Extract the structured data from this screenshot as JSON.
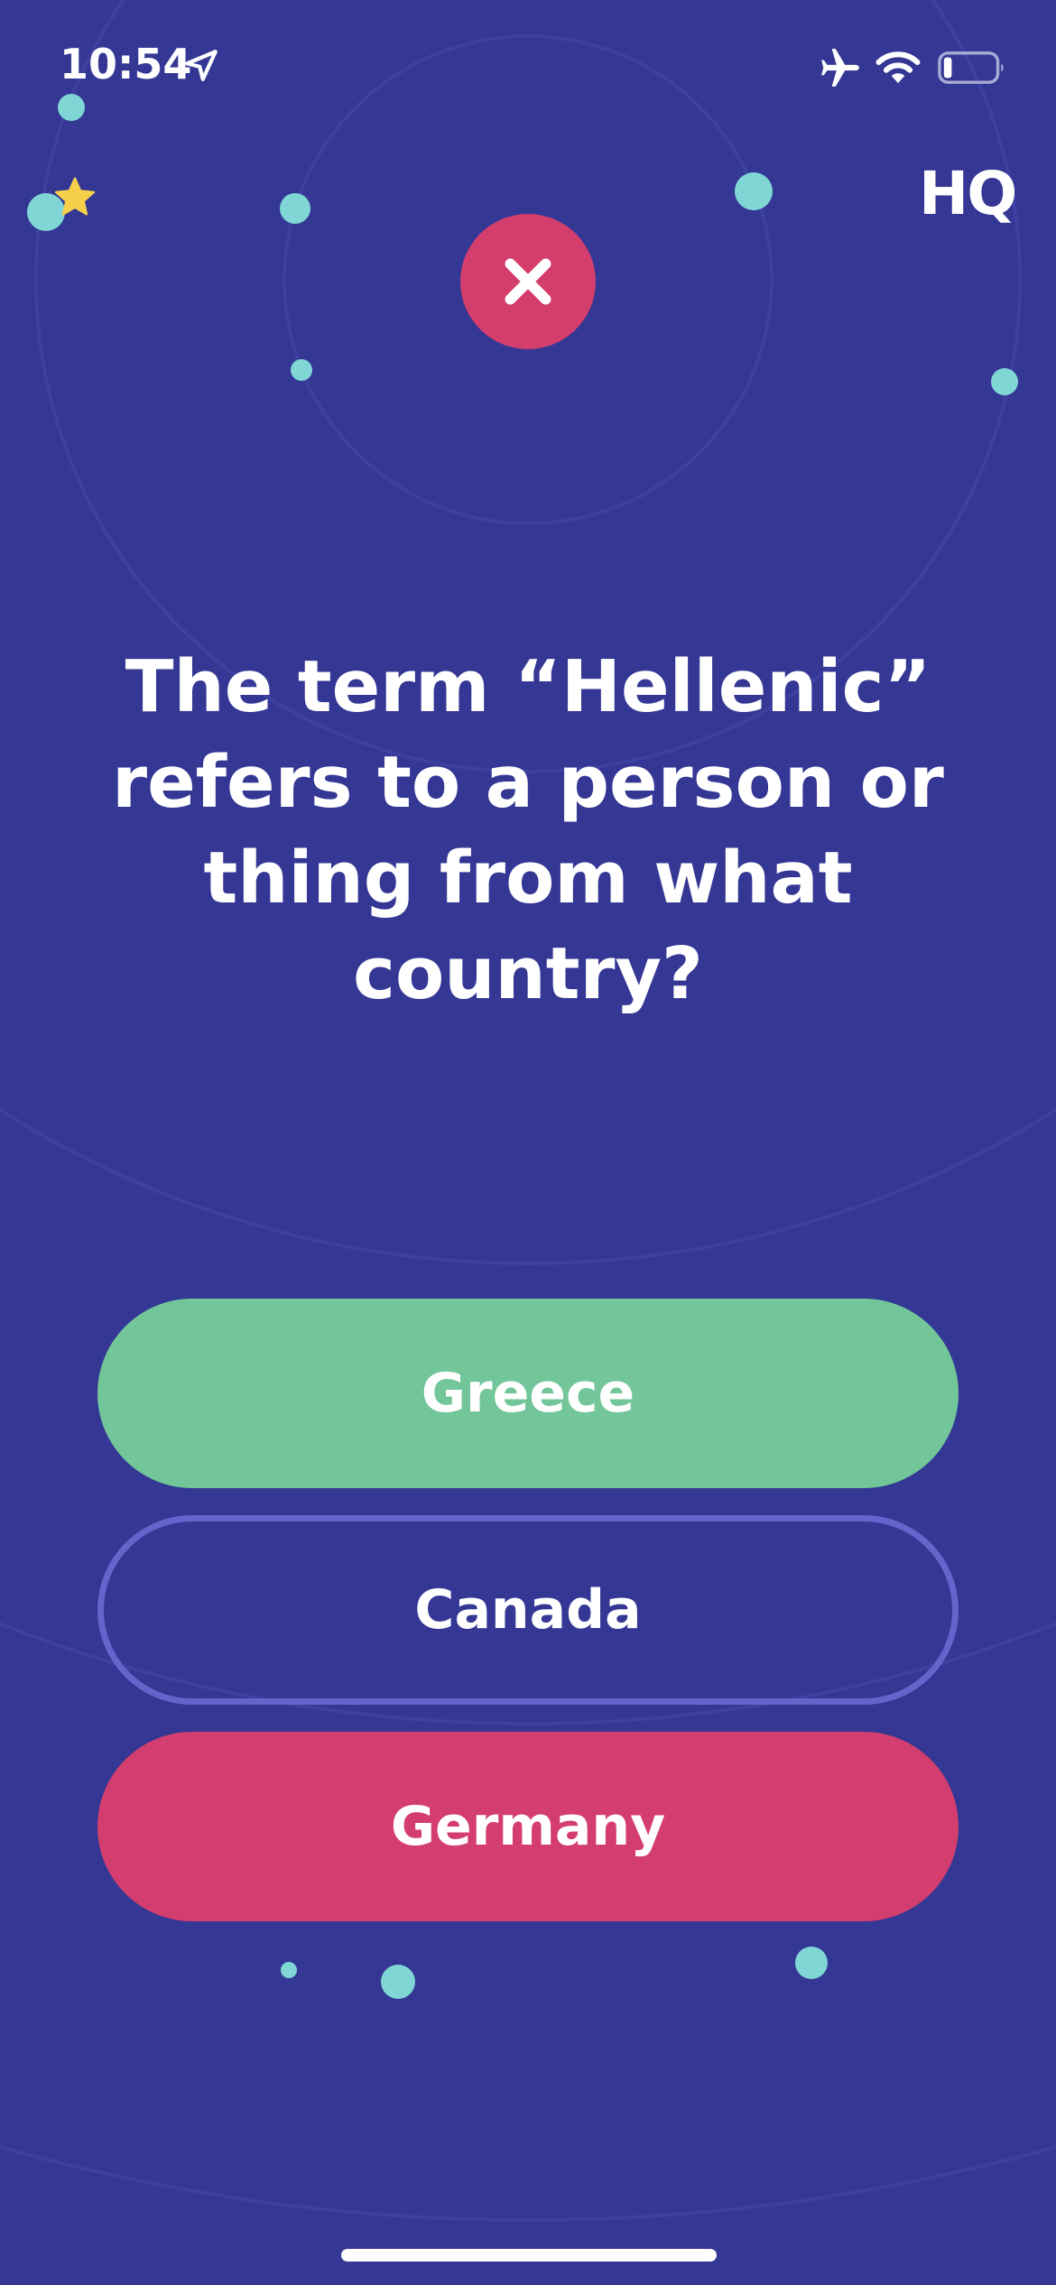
{
  "status_bar": {
    "time": "10:54",
    "icons": [
      "location-arrow-icon",
      "airplane-icon",
      "wifi-icon",
      "battery-low-icon"
    ]
  },
  "header": {
    "logo": "HQ",
    "result_icon": "close-x-icon",
    "star_icon": "star-icon"
  },
  "question": {
    "text": "The term “Hellenic” refers to a person or thing from what country?"
  },
  "answers": [
    {
      "label": "Greece",
      "state": "correct"
    },
    {
      "label": "Canada",
      "state": "unselected"
    },
    {
      "label": "Germany",
      "state": "selected-wrong"
    }
  ],
  "colors": {
    "background": "#343794",
    "correct": "#73c59a",
    "wrong": "#d43e6f",
    "outline": "#6464cc",
    "dots": "#7fd6d4",
    "star": "#f7d04a"
  }
}
